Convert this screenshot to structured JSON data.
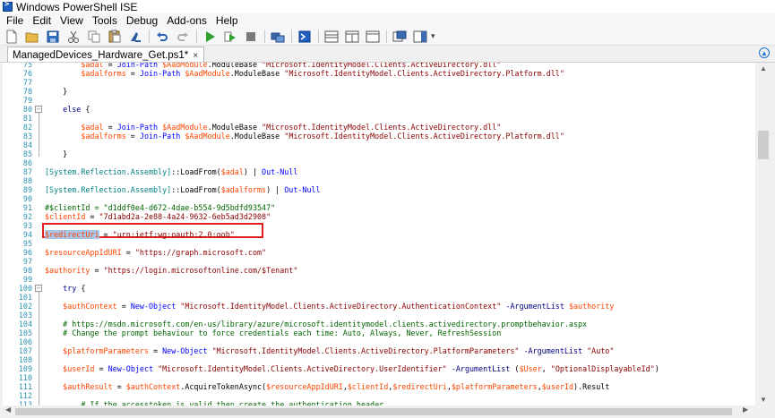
{
  "window": {
    "title": "Windows PowerShell ISE"
  },
  "menu": [
    "File",
    "Edit",
    "View",
    "Tools",
    "Debug",
    "Add-ons",
    "Help"
  ],
  "toolbar": {
    "icons": [
      "new-file-icon",
      "open-folder-icon",
      "save-icon",
      "cut-icon",
      "copy-icon",
      "paste-icon",
      "clear-console-icon",
      "undo-icon",
      "redo-icon",
      "run-script-icon",
      "run-selection-icon",
      "stop-icon",
      "new-remote-tab-icon",
      "start-powershell-icon",
      "show-script-pane-top-icon",
      "show-script-pane-right-icon",
      "show-script-pane-max-icon",
      "show-command-window-icon",
      "show-command-addon-icon"
    ]
  },
  "tab": {
    "label": "ManagedDevices_Hardware_Get.ps1*",
    "close": "×"
  },
  "editor": {
    "lines": [
      {
        "n": "75",
        "tokens": [
          [
            "plain",
            "        "
          ],
          [
            "var",
            "$adal"
          ],
          [
            "plain",
            " = "
          ],
          [
            "cmd",
            "Join-Path"
          ],
          [
            "plain",
            " "
          ],
          [
            "var",
            "$AadModule"
          ],
          [
            "plain",
            ".ModuleBase "
          ],
          [
            "str",
            "\"Microsoft.IdentityModel.Clients.ActiveDirectory.dll\""
          ]
        ]
      },
      {
        "n": "76",
        "tokens": [
          [
            "plain",
            "        "
          ],
          [
            "var",
            "$adalforms"
          ],
          [
            "plain",
            " = "
          ],
          [
            "cmd",
            "Join-Path"
          ],
          [
            "plain",
            " "
          ],
          [
            "var",
            "$AadModule"
          ],
          [
            "plain",
            ".ModuleBase "
          ],
          [
            "str",
            "\"Microsoft.IdentityModel.Clients.ActiveDirectory.Platform.dll\""
          ]
        ]
      },
      {
        "n": "77",
        "tokens": []
      },
      {
        "n": "78",
        "tokens": [
          [
            "plain",
            "    }"
          ]
        ]
      },
      {
        "n": "79",
        "tokens": []
      },
      {
        "n": "80",
        "tokens": [
          [
            "plain",
            "    "
          ],
          [
            "kw",
            "else"
          ],
          [
            "plain",
            " {"
          ]
        ]
      },
      {
        "n": "81",
        "tokens": []
      },
      {
        "n": "82",
        "tokens": [
          [
            "plain",
            "        "
          ],
          [
            "var",
            "$adal"
          ],
          [
            "plain",
            " = "
          ],
          [
            "cmd",
            "Join-Path"
          ],
          [
            "plain",
            " "
          ],
          [
            "var",
            "$AadModule"
          ],
          [
            "plain",
            ".ModuleBase "
          ],
          [
            "str",
            "\"Microsoft.IdentityModel.Clients.ActiveDirectory.dll\""
          ]
        ]
      },
      {
        "n": "83",
        "tokens": [
          [
            "plain",
            "        "
          ],
          [
            "var",
            "$adalforms"
          ],
          [
            "plain",
            " = "
          ],
          [
            "cmd",
            "Join-Path"
          ],
          [
            "plain",
            " "
          ],
          [
            "var",
            "$AadModule"
          ],
          [
            "plain",
            ".ModuleBase "
          ],
          [
            "str",
            "\"Microsoft.IdentityModel.Clients.ActiveDirectory.Platform.dll\""
          ]
        ]
      },
      {
        "n": "84",
        "tokens": []
      },
      {
        "n": "85",
        "tokens": [
          [
            "plain",
            "    }"
          ]
        ]
      },
      {
        "n": "86",
        "tokens": []
      },
      {
        "n": "87",
        "tokens": [
          [
            "type",
            "[System.Reflection.Assembly]"
          ],
          [
            "plain",
            "::LoadFrom("
          ],
          [
            "var",
            "$adal"
          ],
          [
            "plain",
            ") | "
          ],
          [
            "cmd",
            "Out-Null"
          ]
        ]
      },
      {
        "n": "88",
        "tokens": []
      },
      {
        "n": "89",
        "tokens": [
          [
            "type",
            "[System.Reflection.Assembly]"
          ],
          [
            "plain",
            "::LoadFrom("
          ],
          [
            "var",
            "$adalforms"
          ],
          [
            "plain",
            ") | "
          ],
          [
            "cmd",
            "Out-Null"
          ]
        ]
      },
      {
        "n": "90",
        "tokens": []
      },
      {
        "n": "91",
        "tokens": [
          [
            "com",
            "#$clientId = \"d1ddf0e4-d672-4dae-b554-9d5bdfd93547\""
          ]
        ]
      },
      {
        "n": "92",
        "tokens": [
          [
            "var",
            "$clientId"
          ],
          [
            "plain",
            " = "
          ],
          [
            "str",
            "\"7d1abd2a-2e88-4a24-9632-6eb5ad3d2908\""
          ]
        ]
      },
      {
        "n": "93",
        "tokens": []
      },
      {
        "n": "94",
        "tokens": [
          [
            "sel",
            "$redirectUri"
          ],
          [
            "plain",
            " = "
          ],
          [
            "str",
            "\"urn:ietf:wg:oauth:2.0:oob\""
          ]
        ]
      },
      {
        "n": "95",
        "tokens": []
      },
      {
        "n": "96",
        "tokens": [
          [
            "var",
            "$resourceAppIdURI"
          ],
          [
            "plain",
            " = "
          ],
          [
            "str",
            "\"https://graph.microsoft.com\""
          ]
        ]
      },
      {
        "n": "97",
        "tokens": []
      },
      {
        "n": "98",
        "tokens": [
          [
            "var",
            "$authority"
          ],
          [
            "plain",
            " = "
          ],
          [
            "str",
            "\"https://login.microsoftonline.com/$Tenant\""
          ]
        ]
      },
      {
        "n": "99",
        "tokens": []
      },
      {
        "n": "100",
        "tokens": [
          [
            "plain",
            "    "
          ],
          [
            "kw",
            "try"
          ],
          [
            "plain",
            " {"
          ]
        ]
      },
      {
        "n": "101",
        "tokens": []
      },
      {
        "n": "102",
        "tokens": [
          [
            "plain",
            "    "
          ],
          [
            "var",
            "$authContext"
          ],
          [
            "plain",
            " = "
          ],
          [
            "cmd",
            "New-Object"
          ],
          [
            "plain",
            " "
          ],
          [
            "str",
            "\"Microsoft.IdentityModel.Clients.ActiveDirectory.AuthenticationContext\""
          ],
          [
            "plain",
            " "
          ],
          [
            "param",
            "-ArgumentList"
          ],
          [
            "plain",
            " "
          ],
          [
            "var",
            "$authority"
          ]
        ]
      },
      {
        "n": "103",
        "tokens": []
      },
      {
        "n": "104",
        "tokens": [
          [
            "plain",
            "    "
          ],
          [
            "com",
            "# https://msdn.microsoft.com/en-us/library/azure/microsoft.identitymodel.clients.activedirectory.promptbehavior.aspx"
          ]
        ]
      },
      {
        "n": "105",
        "tokens": [
          [
            "plain",
            "    "
          ],
          [
            "com",
            "# Change the prompt behaviour to force credentials each time: Auto, Always, Never, RefreshSession"
          ]
        ]
      },
      {
        "n": "106",
        "tokens": []
      },
      {
        "n": "107",
        "tokens": [
          [
            "plain",
            "    "
          ],
          [
            "var",
            "$platformParameters"
          ],
          [
            "plain",
            " = "
          ],
          [
            "cmd",
            "New-Object"
          ],
          [
            "plain",
            " "
          ],
          [
            "str",
            "\"Microsoft.IdentityModel.Clients.ActiveDirectory.PlatformParameters\""
          ],
          [
            "plain",
            " "
          ],
          [
            "param",
            "-ArgumentList"
          ],
          [
            "plain",
            " "
          ],
          [
            "str",
            "\"Auto\""
          ]
        ]
      },
      {
        "n": "108",
        "tokens": []
      },
      {
        "n": "109",
        "tokens": [
          [
            "plain",
            "    "
          ],
          [
            "var",
            "$userId"
          ],
          [
            "plain",
            " = "
          ],
          [
            "cmd",
            "New-Object"
          ],
          [
            "plain",
            " "
          ],
          [
            "str",
            "\"Microsoft.IdentityModel.Clients.ActiveDirectory.UserIdentifier\""
          ],
          [
            "plain",
            " "
          ],
          [
            "param",
            "-ArgumentList"
          ],
          [
            "plain",
            " ("
          ],
          [
            "var",
            "$User"
          ],
          [
            "plain",
            ", "
          ],
          [
            "str",
            "\"OptionalDisplayableId\""
          ],
          [
            "plain",
            ")"
          ]
        ]
      },
      {
        "n": "110",
        "tokens": []
      },
      {
        "n": "111",
        "tokens": [
          [
            "plain",
            "    "
          ],
          [
            "var",
            "$authResult"
          ],
          [
            "plain",
            " = "
          ],
          [
            "var",
            "$authContext"
          ],
          [
            "plain",
            ".AcquireTokenAsync("
          ],
          [
            "var",
            "$resourceAppIdURI"
          ],
          [
            "plain",
            ","
          ],
          [
            "var",
            "$clientId"
          ],
          [
            "plain",
            ","
          ],
          [
            "var",
            "$redirectUri"
          ],
          [
            "plain",
            ","
          ],
          [
            "var",
            "$platformParameters"
          ],
          [
            "plain",
            ","
          ],
          [
            "var",
            "$userId"
          ],
          [
            "plain",
            ").Result"
          ]
        ]
      },
      {
        "n": "112",
        "tokens": []
      },
      {
        "n": "113",
        "tokens": [
          [
            "plain",
            "        "
          ],
          [
            "com",
            "# If the accesstoken is valid then create the authentication header"
          ]
        ]
      }
    ],
    "folds": [
      "80",
      "100"
    ]
  }
}
